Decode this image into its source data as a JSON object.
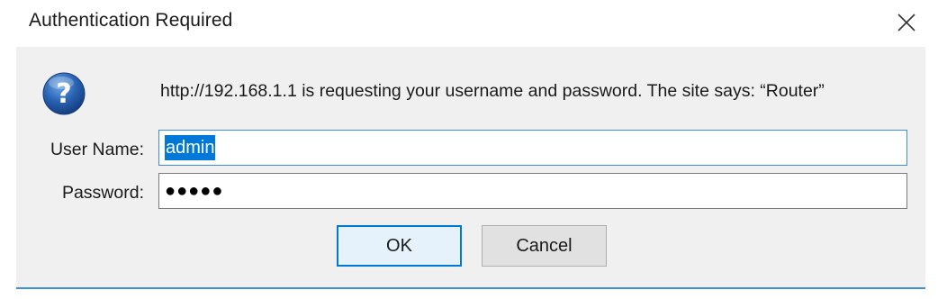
{
  "dialog": {
    "title": "Authentication Required",
    "message": "http://192.168.1.1 is requesting your username and password. The site says: “Router”",
    "username_label": "User Name:",
    "username_value": "admin",
    "password_label": "Password:",
    "password_masked": "●●●●●",
    "ok_label": "OK",
    "cancel_label": "Cancel"
  },
  "icons": {
    "close": "close-icon",
    "question": "question-icon"
  },
  "colors": {
    "accent": "#0078d7",
    "body_bg": "#f0f0f0",
    "selection": "#0078d7",
    "icon_blue": "#1f5fa8"
  }
}
